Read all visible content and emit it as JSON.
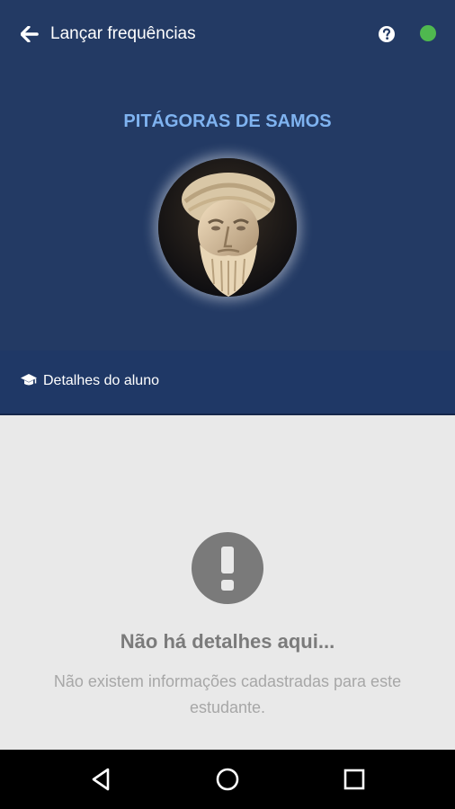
{
  "topbar": {
    "title": "Lançar frequências",
    "back_icon": "arrow-left-icon",
    "help_icon": "question-circle-icon",
    "status_color": "#4fb84f"
  },
  "profile": {
    "name": "PITÁGORAS DE SAMOS",
    "avatar": "pythagoras-bust-photo"
  },
  "details": {
    "icon": "graduation-cap-icon",
    "label": "Detalhes do aluno"
  },
  "empty_state": {
    "icon": "exclamation-circle-icon",
    "title": "Não há detalhes aqui...",
    "description": "Não existem informações cadastradas para este estudante."
  },
  "system_nav": {
    "back": "nav-back-icon",
    "home": "nav-home-icon",
    "recents": "nav-recents-icon"
  },
  "colors": {
    "header_bg": "#233a64",
    "accent_name": "#7fb3f0",
    "content_bg": "#e9e9e9"
  }
}
